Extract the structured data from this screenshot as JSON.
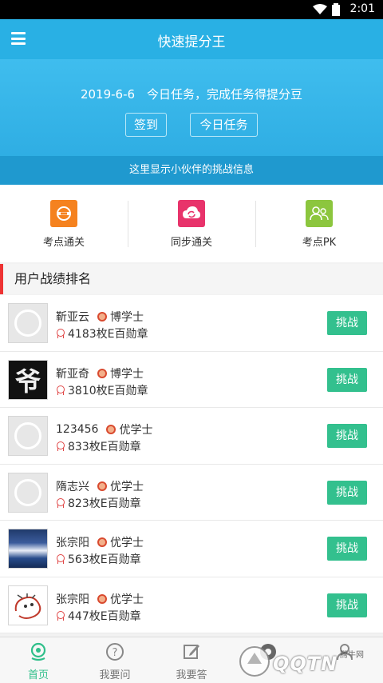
{
  "status": {
    "time": "2:01"
  },
  "appbar": {
    "title": "快速提分王"
  },
  "banner": {
    "task_text": "2019-6-6　今日任务，完成任务得提分豆",
    "signin_label": "签到",
    "today_label": "今日任务",
    "info_text": "这里显示小伙伴的挑战信息"
  },
  "quick": [
    {
      "label": "考点通关",
      "icon": "checkpoint-icon",
      "color": "#f5821f"
    },
    {
      "label": "同步通关",
      "icon": "sync-icon",
      "color": "#e8336b"
    },
    {
      "label": "考点PK",
      "icon": "pk-icon",
      "color": "#8cc63e"
    }
  ],
  "ranking": {
    "title": "用户战绩排名",
    "challenge_label": "挑战",
    "users": [
      {
        "name": "靳亚云",
        "level": "博学士",
        "medals": "4183枚E百勋章",
        "avatar": "default"
      },
      {
        "name": "靳亚奇",
        "level": "博学士",
        "medals": "3810枚E百勋章",
        "avatar": "glyph",
        "glyph": "爷"
      },
      {
        "name": "123456",
        "level": "优学士",
        "medals": "833枚E百勋章",
        "avatar": "default"
      },
      {
        "name": "隋志兴",
        "level": "优学士",
        "medals": "823枚E百勋章",
        "avatar": "default"
      },
      {
        "name": "张宗阳",
        "level": "优学士",
        "medals": "563枚E百勋章",
        "avatar": "wave"
      },
      {
        "name": "张宗阳",
        "level": "优学士",
        "medals": "447枚E百勋章",
        "avatar": "drawn"
      }
    ]
  },
  "tabs": [
    {
      "label": "首页",
      "icon": "home-icon",
      "active": true
    },
    {
      "label": "我要问",
      "icon": "question-icon"
    },
    {
      "label": "我要答",
      "icon": "edit-icon"
    },
    {
      "label": "",
      "icon": "ball-icon"
    },
    {
      "label": "",
      "icon": "profile-icon"
    }
  ],
  "watermark": {
    "text": "QQTN",
    "small": "腾牛网"
  },
  "colors": {
    "primary": "#29b0e4",
    "accent": "#33c08e",
    "section_bar": "#e33333"
  }
}
